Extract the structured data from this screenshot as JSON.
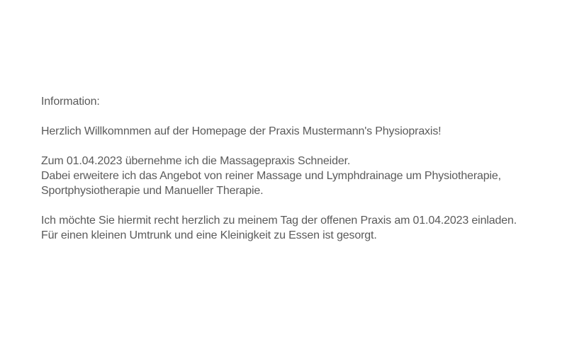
{
  "info": {
    "heading": "Information:",
    "welcome": "Herzlich Willkomnmen auf der Homepage der Praxis Mustermann's Physiopraxis!",
    "takeover": [
      "Zum 01.04.2023 übernehme ich die Massagepraxis Schneider.",
      "Dabei erweitere ich das Angebot von reiner Massage und Lymphdrainage um Physiotherapie,",
      "Sportphysiotherapie und Manueller Therapie."
    ],
    "invitation": [
      "Ich möchte Sie hiermit recht herzlich zu meinem Tag der offenen Praxis am 01.04.2023 einladen.",
      "Für einen kleinen Umtrunk und eine Kleinigkeit zu Essen ist gesorgt."
    ]
  }
}
